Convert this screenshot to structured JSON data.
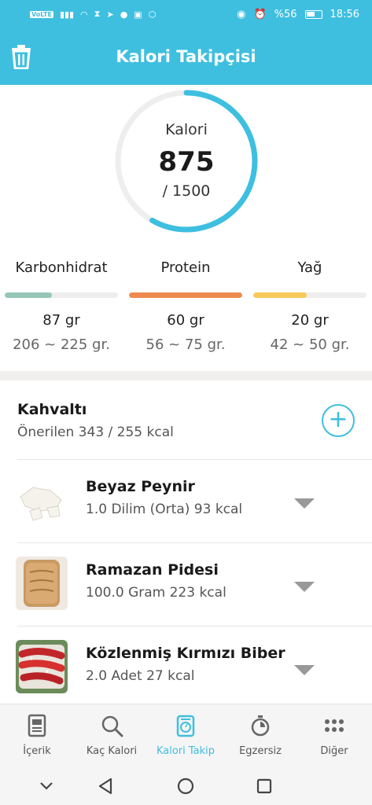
{
  "statusbar": {
    "network": "VoLTE",
    "battery": "%56",
    "time": "18:56"
  },
  "header": {
    "title": "Kalori Takipçisi"
  },
  "calories": {
    "label": "Kalori",
    "value": "875",
    "target": "/ 1500",
    "progress": 0.583
  },
  "macros": [
    {
      "name": "Karbonhidrat",
      "amount": "87 gr",
      "range": "206 ~ 225 gr.",
      "progress": 0.42,
      "color": "#95c6b8"
    },
    {
      "name": "Protein",
      "amount": "60 gr",
      "range": "56 ~ 75 gr.",
      "progress": 1.0,
      "color": "#ef8a4f"
    },
    {
      "name": "Yağ",
      "amount": "20 gr",
      "range": "42 ~ 50 gr.",
      "progress": 0.47,
      "color": "#f6c95a"
    }
  ],
  "meal": {
    "title": "Kahvaltı",
    "subtitle": "Önerilen 343 / 255 kcal"
  },
  "foods": [
    {
      "name": "Beyaz Peynir",
      "detail": "1.0 Dilim (Orta) 93 kcal"
    },
    {
      "name": "Ramazan Pidesi",
      "detail": "100.0 Gram 223 kcal"
    },
    {
      "name": "Közlenmiş Kırmızı Biber",
      "detail": "2.0 Adet 27 kcal"
    }
  ],
  "nav": [
    {
      "label": "İçerik",
      "icon": "document-icon"
    },
    {
      "label": "Kaç Kalori",
      "icon": "search-icon"
    },
    {
      "label": "Kalori Takip",
      "icon": "scale-icon",
      "active": true
    },
    {
      "label": "Egzersiz",
      "icon": "stopwatch-icon"
    },
    {
      "label": "Diğer",
      "icon": "grid-dots-icon"
    }
  ],
  "colors": {
    "accent": "#3ebfe0",
    "ringTrack": "#eeeeee"
  }
}
